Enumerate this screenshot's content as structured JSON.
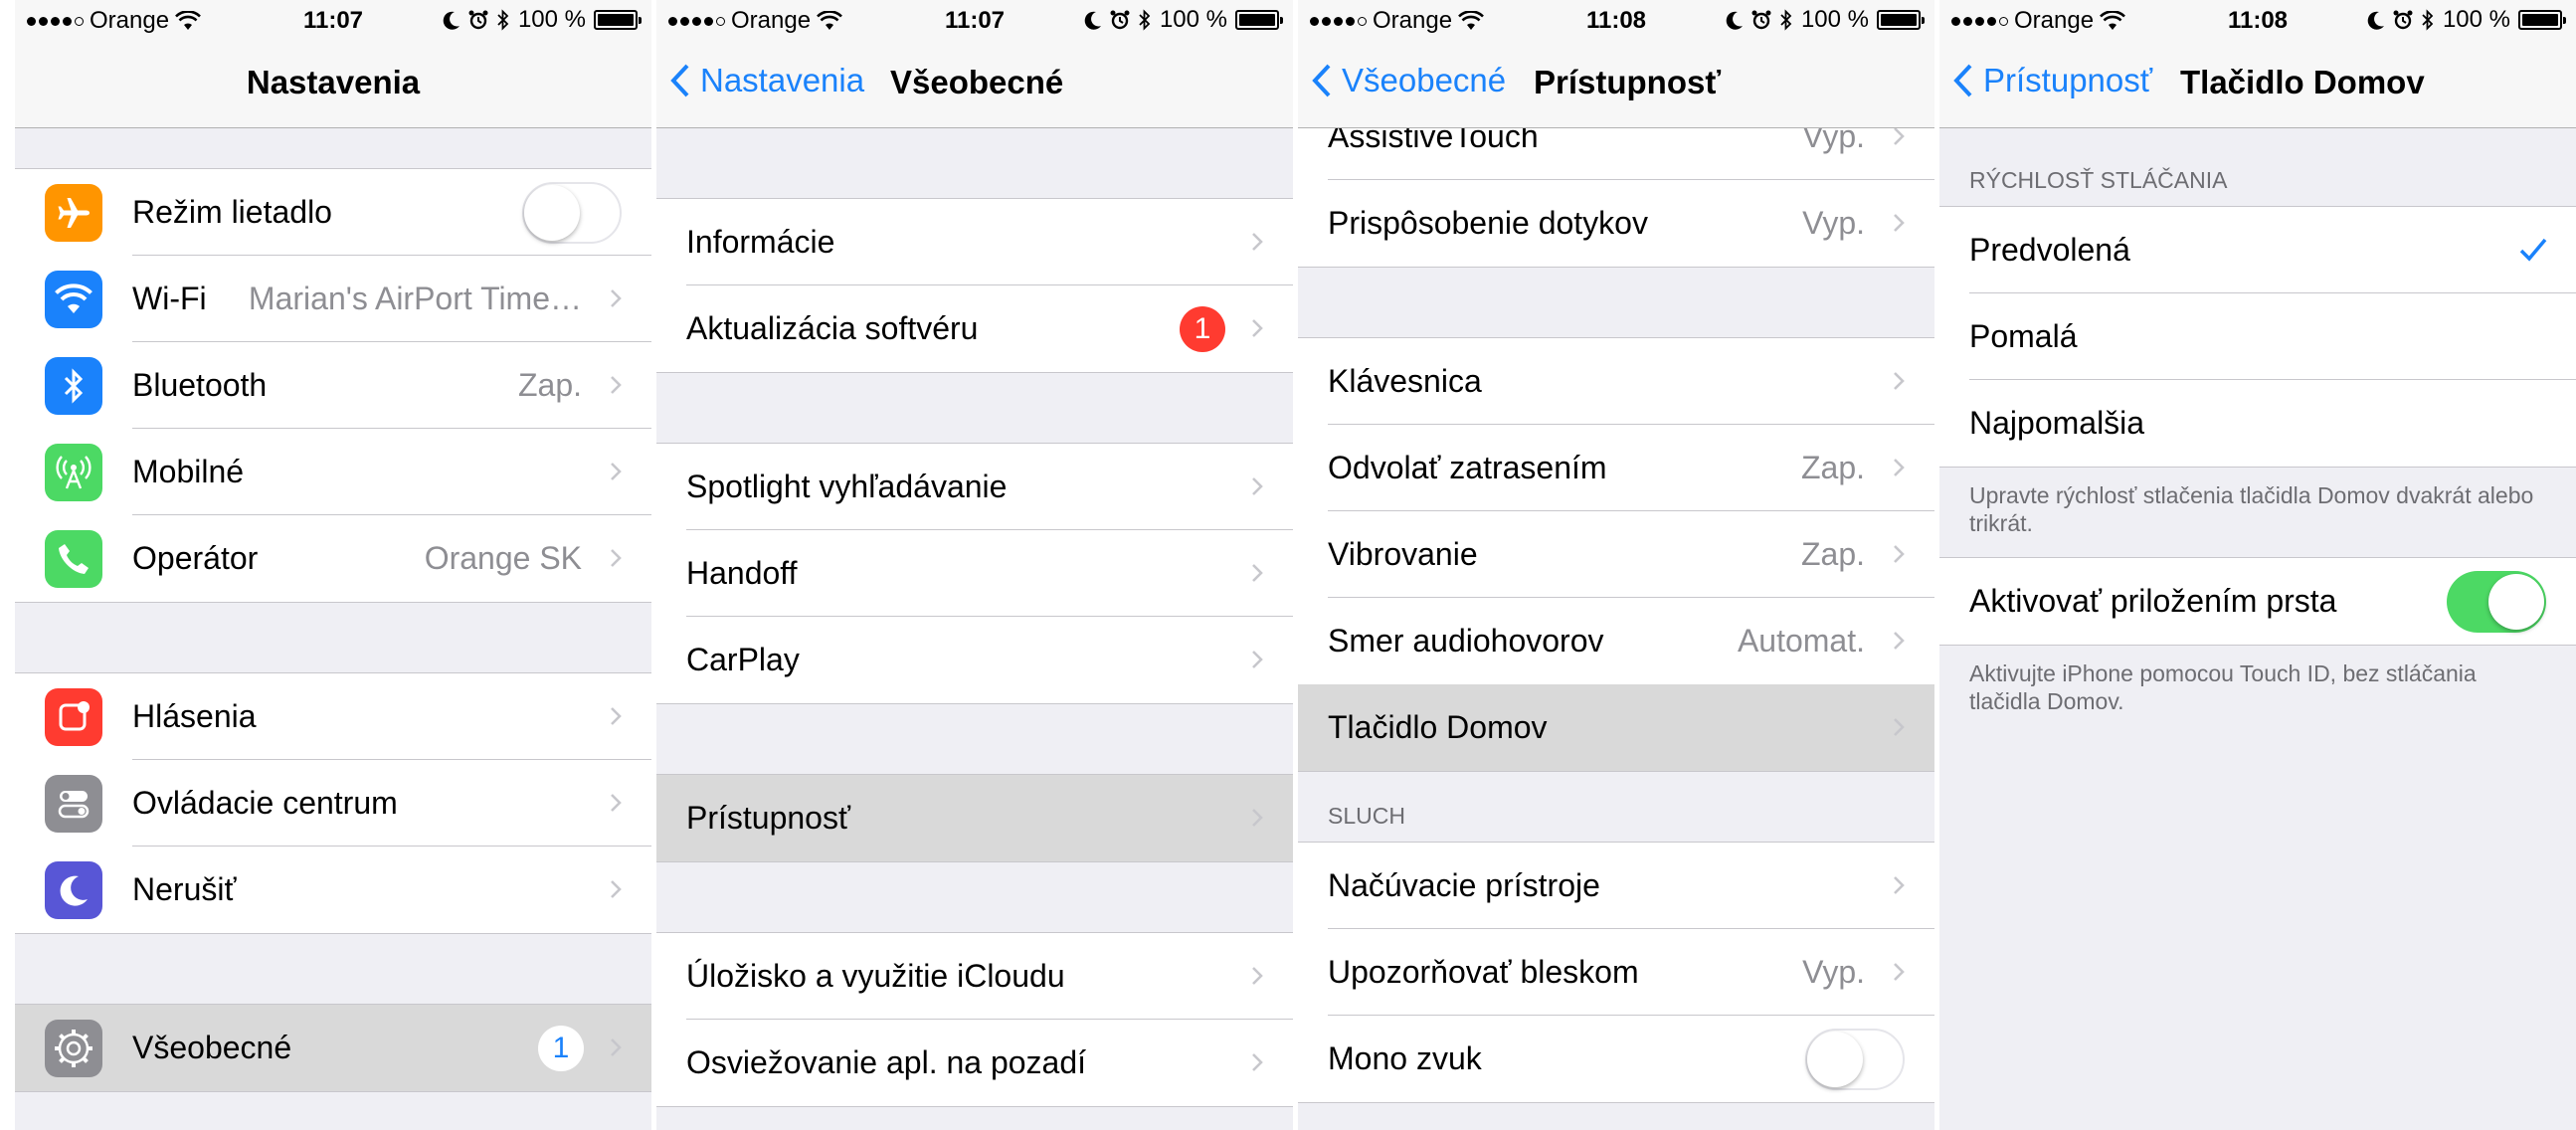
{
  "colors": {
    "accent": "#1a82fb",
    "toggle_on": "#4cd964",
    "badge_red": "#ff3b30",
    "secondary_text": "#8e8e93"
  },
  "screens": [
    {
      "status": {
        "carrier": "Orange",
        "time": "11:07",
        "battery": "100 %"
      },
      "nav": {
        "title": "Nastavenia"
      },
      "rows": [
        {
          "label": "Režim lietadlo",
          "icon": "airplane-icon"
        },
        {
          "label": "Wi-Fi",
          "value": "Marian's AirPort Time…",
          "icon": "wifi-icon"
        },
        {
          "label": "Bluetooth",
          "value": "Zap.",
          "icon": "bluetooth-icon"
        },
        {
          "label": "Mobilné",
          "icon": "cellular-icon"
        },
        {
          "label": "Operátor",
          "value": "Orange SK",
          "icon": "phone-icon"
        },
        {
          "label": "Hlásenia",
          "icon": "notifications-icon"
        },
        {
          "label": "Ovládacie centrum",
          "icon": "control-center-icon"
        },
        {
          "label": "Nerušiť",
          "icon": "moon-icon"
        },
        {
          "label": "Všeobecné",
          "badge": "1",
          "icon": "gear-icon"
        }
      ]
    },
    {
      "status": {
        "carrier": "Orange",
        "time": "11:07",
        "battery": "100 %"
      },
      "nav": {
        "back": "Nastavenia",
        "title": "Všeobecné"
      },
      "rows": [
        {
          "label": "Informácie"
        },
        {
          "label": "Aktualizácia softvéru",
          "badge": "1"
        },
        {
          "label": "Spotlight vyhľadávanie"
        },
        {
          "label": "Handoff"
        },
        {
          "label": "CarPlay"
        },
        {
          "label": "Prístupnosť"
        },
        {
          "label": "Úložisko a využitie iCloudu"
        },
        {
          "label": "Osviežovanie apl. na pozadí"
        }
      ]
    },
    {
      "status": {
        "carrier": "Orange",
        "time": "11:08",
        "battery": "100 %"
      },
      "nav": {
        "back": "Všeobecné",
        "title": "Prístupnosť"
      },
      "rows": [
        {
          "label": "AssistiveTouch",
          "value": "Vyp."
        },
        {
          "label": "Prispôsobenie dotykov",
          "value": "Vyp."
        },
        {
          "label": "Klávesnica"
        },
        {
          "label": "Odvolať zatrasením",
          "value": "Zap."
        },
        {
          "label": "Vibrovanie",
          "value": "Zap."
        },
        {
          "label": "Smer audiohovorov",
          "value": "Automat."
        },
        {
          "label": "Tlačidlo Domov"
        },
        {
          "label": "Načúvacie prístroje"
        },
        {
          "label": "Upozorňovať bleskom",
          "value": "Vyp."
        },
        {
          "label": "Mono zvuk"
        }
      ],
      "section_sluch": "SLUCH"
    },
    {
      "status": {
        "carrier": "Orange",
        "time": "11:08",
        "battery": "100 %"
      },
      "nav": {
        "back": "Prístupnosť",
        "title": "Tlačidlo Domov"
      },
      "section_speed": "RÝCHLOSŤ STLÁČANIA",
      "rows": [
        {
          "label": "Predvolená"
        },
        {
          "label": "Pomalá"
        },
        {
          "label": "Najpomalšia"
        },
        {
          "label": "Aktivovať priložením prsta"
        }
      ],
      "footer_speed": "Upravte rýchlosť stlačenia tlačidla Domov dvakrát alebo trikrát.",
      "footer_touchid": "Aktivujte iPhone pomocou Touch ID, bez stláčania tlačidla Domov."
    }
  ]
}
